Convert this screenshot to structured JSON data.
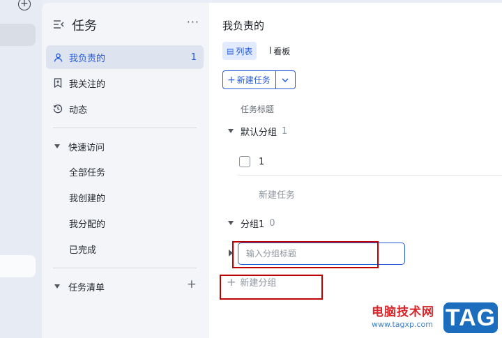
{
  "rail": {
    "add_icon": "plus-circle-icon"
  },
  "sidebar": {
    "title": "任务",
    "more": "···",
    "nav": [
      {
        "label": "我负责的",
        "count": "1",
        "icon": "person-icon",
        "active": true
      },
      {
        "label": "我关注的",
        "icon": "bookmark-icon"
      },
      {
        "label": "动态",
        "icon": "history-icon"
      }
    ],
    "quick_access": {
      "label": "快速访问",
      "items": [
        "全部任务",
        "我创建的",
        "我分配的",
        "已完成"
      ]
    },
    "task_list": {
      "label": "任务清单",
      "add": "+"
    }
  },
  "main": {
    "title": "我负责的",
    "tabs": [
      {
        "label": "列表",
        "icon": "list-icon",
        "active": true
      },
      {
        "label": "看板",
        "icon": "kanban-icon"
      }
    ],
    "new_task_button": "新建任务",
    "column_header": "任务标题",
    "groups": [
      {
        "name": "默认分组",
        "count": "1",
        "tasks": [
          "1"
        ],
        "add_task": "新建任务"
      },
      {
        "name": "分组1",
        "count": "0"
      }
    ],
    "group_title_input": {
      "placeholder": "输入分组标题",
      "value": ""
    },
    "new_group": "新建分组"
  },
  "watermark": {
    "site": "电脑技术网",
    "url": "www.tagxp.com",
    "tag": "TAG"
  },
  "colors": {
    "accent": "#245bdb",
    "highlight_box": "#c00000",
    "active_nav_bg": "#dde3ef"
  }
}
